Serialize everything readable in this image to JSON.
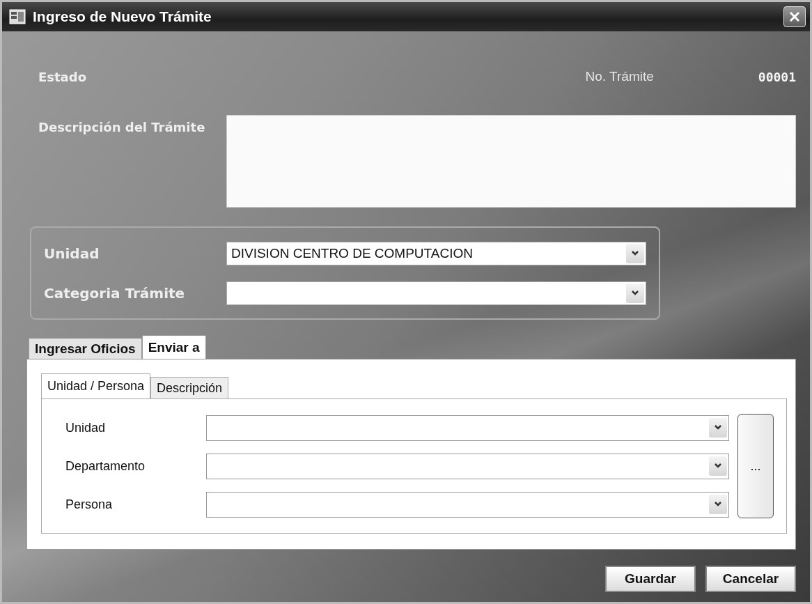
{
  "window": {
    "title": "Ingreso de Nuevo Trámite"
  },
  "header": {
    "estado_label": "Estado",
    "numero_label": "No. Trámite",
    "numero_value": "00001"
  },
  "descripcion": {
    "label": "Descripción del Trámite"
  },
  "group": {
    "fields": [
      {
        "label": "Unidad",
        "value": "DIVISION CENTRO DE COMPUTACION"
      },
      {
        "label": "Categoria Trámite"
      }
    ]
  },
  "tabs": [
    {
      "label": "Ingresar  Oficios",
      "selected": false
    },
    {
      "label": "Enviar a",
      "selected": true
    }
  ],
  "subtabs": [
    {
      "label": "Unidad / Persona",
      "selected": true
    },
    {
      "label": "Descripción",
      "selected": false
    }
  ],
  "destination_fields": [
    {
      "label": "Unidad"
    },
    {
      "label": "Departamento"
    },
    {
      "label": "Persona"
    }
  ],
  "browse_button": "...",
  "buttons": [
    "Guardar",
    "Cancelar"
  ]
}
